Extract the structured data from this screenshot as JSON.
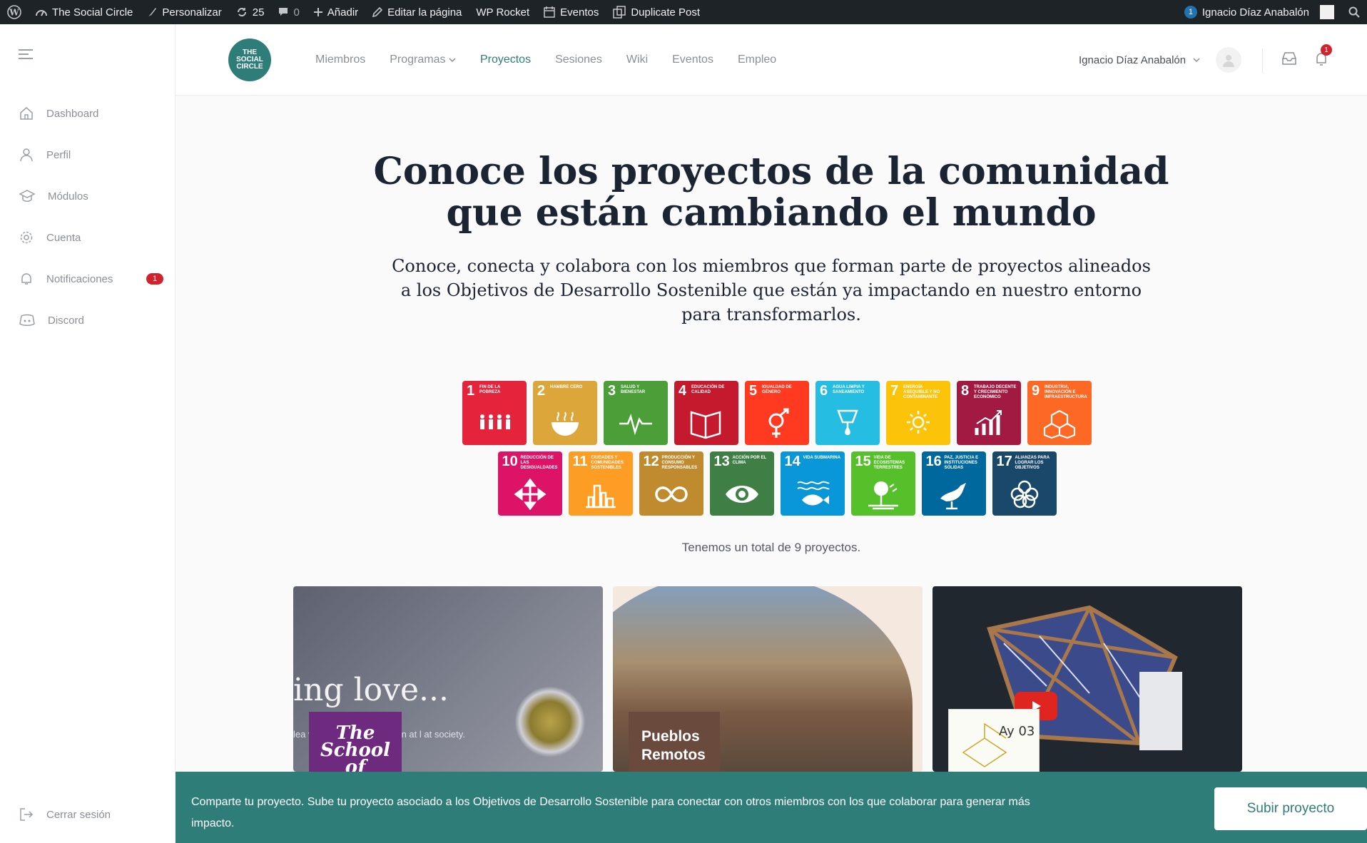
{
  "adminbar": {
    "site": "The Social Circle",
    "customize": "Personalizar",
    "updates": "25",
    "comments": "0",
    "add": "Añadir",
    "edit": "Editar la página",
    "rocket": "WP Rocket",
    "events": "Eventos",
    "duplicate": "Duplicate Post",
    "notif_count": "1",
    "user": "Ignacio Díaz Anabalón"
  },
  "sidebar": {
    "items": [
      {
        "label": "Dashboard",
        "icon": "home-icon"
      },
      {
        "label": "Perfil",
        "icon": "user-icon"
      },
      {
        "label": "Módulos",
        "icon": "graduation-cap-icon"
      },
      {
        "label": "Cuenta",
        "icon": "gear-icon"
      },
      {
        "label": "Notificaciones",
        "icon": "bell-icon",
        "badge": "1"
      },
      {
        "label": "Discord",
        "icon": "discord-icon"
      }
    ],
    "logout": "Cerrar sesión"
  },
  "header": {
    "logo_lines": [
      "THE",
      "SOCIAL",
      "CIRCLE"
    ],
    "nav": [
      "Miembros",
      "Programas",
      "Proyectos",
      "Sesiones",
      "Wiki",
      "Eventos",
      "Empleo"
    ],
    "active_nav": "Proyectos",
    "user_name": "Ignacio Díaz Anabalón",
    "bell_count": "1"
  },
  "hero": {
    "title_line1": "Conoce los proyectos de la comunidad",
    "title_line2": "que están cambiando el mundo",
    "subtitle": "Conoce, conecta y colabora con los miembros que forman parte de proyectos alineados a los Objetivos de Desarrollo Sostenible que están ya impactando en nuestro entorno para transformarlos."
  },
  "sdgs": [
    {
      "num": "1",
      "label": "Fin de la pobreza",
      "color": "#e5243b"
    },
    {
      "num": "2",
      "label": "Hambre cero",
      "color": "#dda63a"
    },
    {
      "num": "3",
      "label": "Salud y bienestar",
      "color": "#4c9f38"
    },
    {
      "num": "4",
      "label": "Educación de calidad",
      "color": "#c5192d"
    },
    {
      "num": "5",
      "label": "Igualdad de género",
      "color": "#ff3a21"
    },
    {
      "num": "6",
      "label": "Agua limpia y saneamiento",
      "color": "#26bde2"
    },
    {
      "num": "7",
      "label": "Energía asequible y no contaminante",
      "color": "#fcc30b"
    },
    {
      "num": "8",
      "label": "Trabajo decente y crecimiento económico",
      "color": "#a21942"
    },
    {
      "num": "9",
      "label": "Industria, innovación e infraestructura",
      "color": "#fd6925"
    },
    {
      "num": "10",
      "label": "Reducción de las desigualdades",
      "color": "#dd1367"
    },
    {
      "num": "11",
      "label": "Ciudades y comunidades sostenibles",
      "color": "#fd9d24"
    },
    {
      "num": "12",
      "label": "Producción y consumo responsables",
      "color": "#bf8b2e"
    },
    {
      "num": "13",
      "label": "Acción por el clima",
      "color": "#3f7e44"
    },
    {
      "num": "14",
      "label": "Vida submarina",
      "color": "#0a97d9"
    },
    {
      "num": "15",
      "label": "Vida de ecosistemas terrestres",
      "color": "#56c02b"
    },
    {
      "num": "16",
      "label": "Paz, justicia e instituciones sólidas",
      "color": "#00689d"
    },
    {
      "num": "17",
      "label": "Alianzas para lograr los objetivos",
      "color": "#19486a"
    }
  ],
  "total": "Tenemos un total de 9 proyectos.",
  "cards": [
    {
      "script": "ing love...",
      "badge": "The School of",
      "text": "lea          v ways of \"living love\" in        at l          at society."
    },
    {
      "tag": "Pueblos Remotos"
    },
    {
      "sketch": "Ay 03"
    }
  ],
  "banner": {
    "text": "Comparte tu proyecto. Sube tu proyecto asociado a los Objetivos de Desarrollo Sostenible para conectar con otros miembros con los que colaborar para generar más impacto.",
    "button": "Subir proyecto"
  }
}
